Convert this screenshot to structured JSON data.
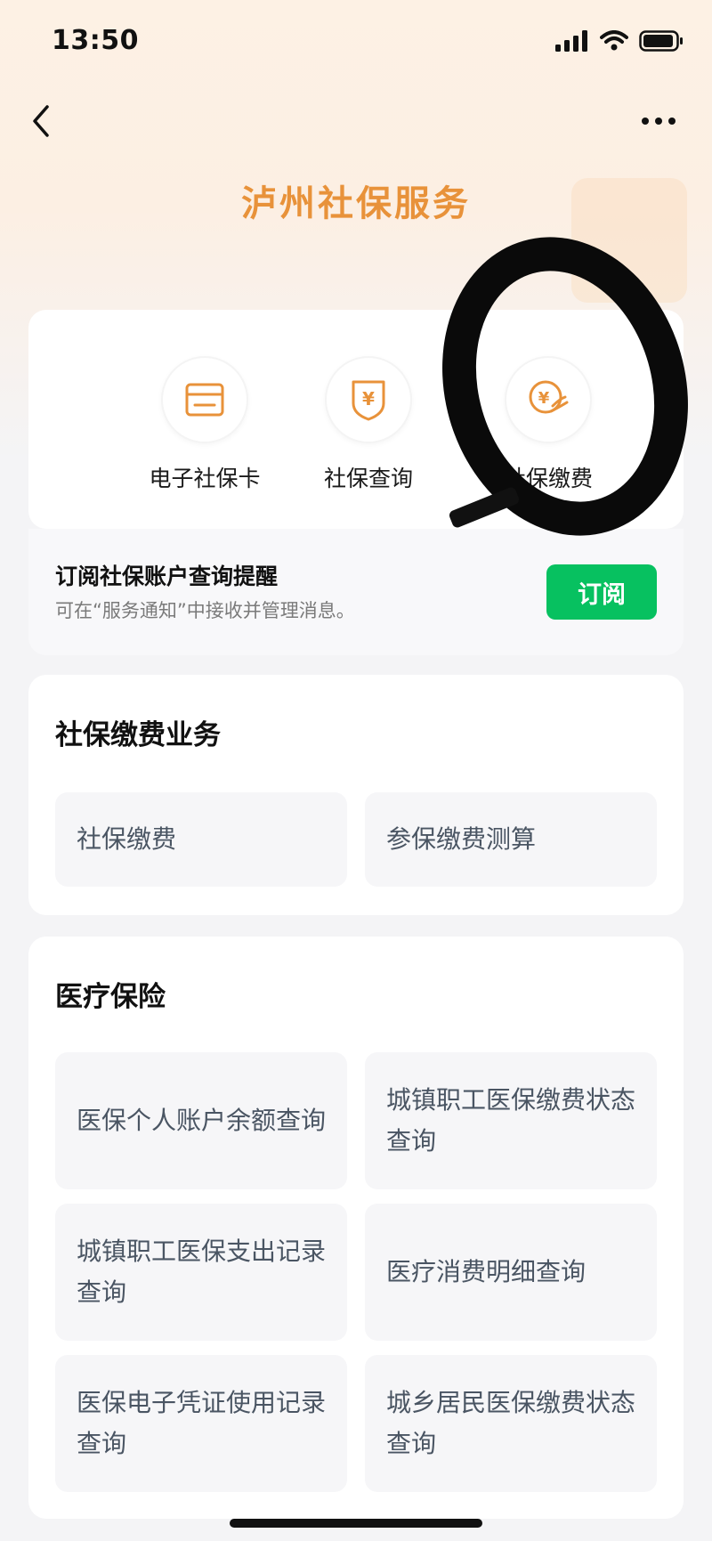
{
  "status": {
    "time": "13:50"
  },
  "nav": {
    "back_icon": "chevron-left-icon",
    "more_icon": "more-dots-icon"
  },
  "page": {
    "title": "泸州社保服务"
  },
  "services": [
    {
      "label": "电子社保卡",
      "icon": "card-icon"
    },
    {
      "label": "社保查询",
      "icon": "yuan-shield-icon"
    },
    {
      "label": "社保缴费",
      "icon": "yuan-payment-icon"
    }
  ],
  "subscribe": {
    "title": "订阅社保账户查询提醒",
    "desc": "可在“服务通知”中接收并管理消息。",
    "button": "订阅"
  },
  "business": {
    "title": "社保缴费业务",
    "items": [
      "社保缴费",
      "参保缴费测算"
    ]
  },
  "medical": {
    "title": "医疗保险",
    "items": [
      "医保个人账户余额查询",
      "城镇职工医保缴费状态查询",
      "城镇职工医保支出记录查询",
      "医疗消费明细查询",
      "医保电子凭证使用记录查询",
      "城乡居民医保缴费状态查询"
    ]
  },
  "colors": {
    "accent": "#e8923a",
    "subscribe_button": "#07c160",
    "tile_text": "#4a5563"
  }
}
